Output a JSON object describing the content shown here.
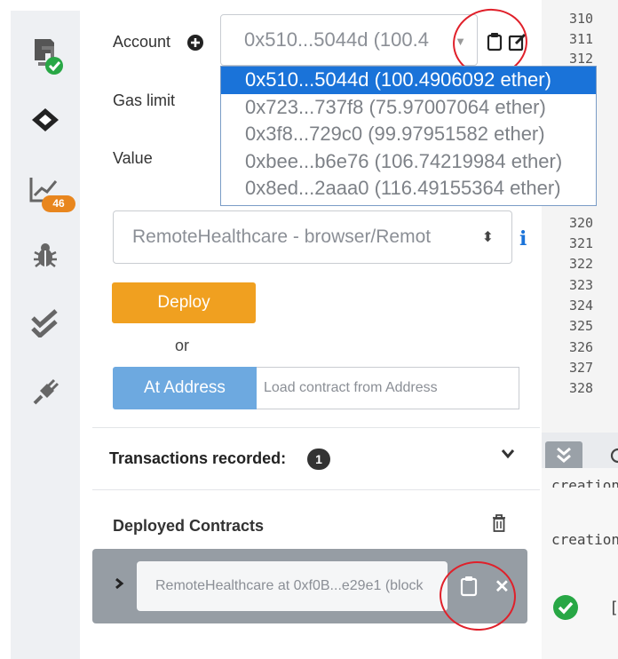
{
  "rail": {
    "badge_count": "46"
  },
  "run": {
    "account_label": "Account",
    "account_selected": "0x510...5044d (100.4",
    "gas_limit_label": "Gas limit",
    "value_label": "Value",
    "accounts": [
      "0x510...5044d (100.4906092 ether)",
      "0x723...737f8 (75.97007064 ether)",
      "0x3f8...729c0 (99.97951582 ether)",
      "0xbee...b6e76 (106.74219984 ether)",
      "0x8ed...2aaa0 (116.49155364 ether)"
    ],
    "contract_selected": "RemoteHealthcare - browser/Remot",
    "deploy_label": "Deploy",
    "or_label": "or",
    "at_address_label": "At Address",
    "at_address_placeholder": "Load contract from Address",
    "transactions_label": "Transactions recorded:",
    "transactions_count": "1",
    "deployed_label": "Deployed Contracts",
    "instance_label": "RemoteHealthcare at 0xf0B...e29e1 (block"
  },
  "editor": {
    "top_lines": [
      "310",
      "311",
      "312"
    ],
    "bottom_lines": [
      "320",
      "321",
      "322",
      "323",
      "324",
      "325",
      "326",
      "327",
      "328"
    ]
  },
  "console": {
    "line1": "creation",
    "line2": "creation",
    "line3": "["
  },
  "colors": {
    "accent": "#f0a020",
    "selected": "#1a73d9",
    "annotation": "#e0202a",
    "success": "#28a745"
  }
}
